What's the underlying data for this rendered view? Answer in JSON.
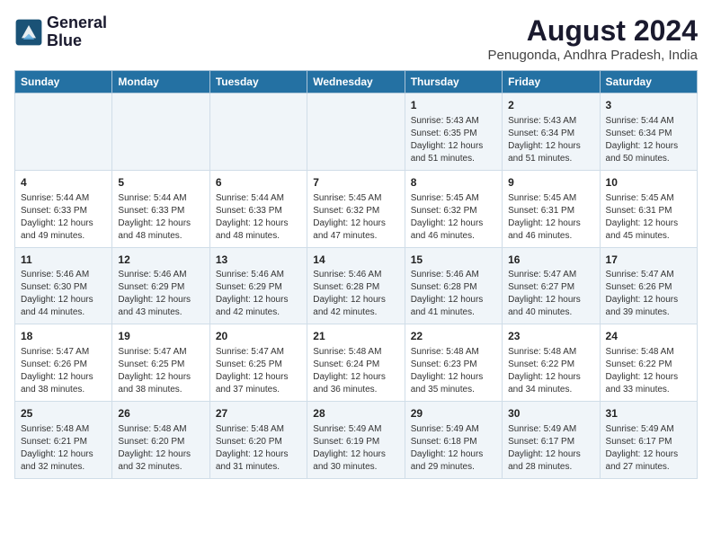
{
  "header": {
    "logo_line1": "General",
    "logo_line2": "Blue",
    "month": "August 2024",
    "location": "Penugonda, Andhra Pradesh, India"
  },
  "days_of_week": [
    "Sunday",
    "Monday",
    "Tuesday",
    "Wednesday",
    "Thursday",
    "Friday",
    "Saturday"
  ],
  "weeks": [
    [
      {
        "day": "",
        "info": ""
      },
      {
        "day": "",
        "info": ""
      },
      {
        "day": "",
        "info": ""
      },
      {
        "day": "",
        "info": ""
      },
      {
        "day": "1",
        "info": "Sunrise: 5:43 AM\nSunset: 6:35 PM\nDaylight: 12 hours and 51 minutes."
      },
      {
        "day": "2",
        "info": "Sunrise: 5:43 AM\nSunset: 6:34 PM\nDaylight: 12 hours and 51 minutes."
      },
      {
        "day": "3",
        "info": "Sunrise: 5:44 AM\nSunset: 6:34 PM\nDaylight: 12 hours and 50 minutes."
      }
    ],
    [
      {
        "day": "4",
        "info": "Sunrise: 5:44 AM\nSunset: 6:33 PM\nDaylight: 12 hours and 49 minutes."
      },
      {
        "day": "5",
        "info": "Sunrise: 5:44 AM\nSunset: 6:33 PM\nDaylight: 12 hours and 48 minutes."
      },
      {
        "day": "6",
        "info": "Sunrise: 5:44 AM\nSunset: 6:33 PM\nDaylight: 12 hours and 48 minutes."
      },
      {
        "day": "7",
        "info": "Sunrise: 5:45 AM\nSunset: 6:32 PM\nDaylight: 12 hours and 47 minutes."
      },
      {
        "day": "8",
        "info": "Sunrise: 5:45 AM\nSunset: 6:32 PM\nDaylight: 12 hours and 46 minutes."
      },
      {
        "day": "9",
        "info": "Sunrise: 5:45 AM\nSunset: 6:31 PM\nDaylight: 12 hours and 46 minutes."
      },
      {
        "day": "10",
        "info": "Sunrise: 5:45 AM\nSunset: 6:31 PM\nDaylight: 12 hours and 45 minutes."
      }
    ],
    [
      {
        "day": "11",
        "info": "Sunrise: 5:46 AM\nSunset: 6:30 PM\nDaylight: 12 hours and 44 minutes."
      },
      {
        "day": "12",
        "info": "Sunrise: 5:46 AM\nSunset: 6:29 PM\nDaylight: 12 hours and 43 minutes."
      },
      {
        "day": "13",
        "info": "Sunrise: 5:46 AM\nSunset: 6:29 PM\nDaylight: 12 hours and 42 minutes."
      },
      {
        "day": "14",
        "info": "Sunrise: 5:46 AM\nSunset: 6:28 PM\nDaylight: 12 hours and 42 minutes."
      },
      {
        "day": "15",
        "info": "Sunrise: 5:46 AM\nSunset: 6:28 PM\nDaylight: 12 hours and 41 minutes."
      },
      {
        "day": "16",
        "info": "Sunrise: 5:47 AM\nSunset: 6:27 PM\nDaylight: 12 hours and 40 minutes."
      },
      {
        "day": "17",
        "info": "Sunrise: 5:47 AM\nSunset: 6:26 PM\nDaylight: 12 hours and 39 minutes."
      }
    ],
    [
      {
        "day": "18",
        "info": "Sunrise: 5:47 AM\nSunset: 6:26 PM\nDaylight: 12 hours and 38 minutes."
      },
      {
        "day": "19",
        "info": "Sunrise: 5:47 AM\nSunset: 6:25 PM\nDaylight: 12 hours and 38 minutes."
      },
      {
        "day": "20",
        "info": "Sunrise: 5:47 AM\nSunset: 6:25 PM\nDaylight: 12 hours and 37 minutes."
      },
      {
        "day": "21",
        "info": "Sunrise: 5:48 AM\nSunset: 6:24 PM\nDaylight: 12 hours and 36 minutes."
      },
      {
        "day": "22",
        "info": "Sunrise: 5:48 AM\nSunset: 6:23 PM\nDaylight: 12 hours and 35 minutes."
      },
      {
        "day": "23",
        "info": "Sunrise: 5:48 AM\nSunset: 6:22 PM\nDaylight: 12 hours and 34 minutes."
      },
      {
        "day": "24",
        "info": "Sunrise: 5:48 AM\nSunset: 6:22 PM\nDaylight: 12 hours and 33 minutes."
      }
    ],
    [
      {
        "day": "25",
        "info": "Sunrise: 5:48 AM\nSunset: 6:21 PM\nDaylight: 12 hours and 32 minutes."
      },
      {
        "day": "26",
        "info": "Sunrise: 5:48 AM\nSunset: 6:20 PM\nDaylight: 12 hours and 32 minutes."
      },
      {
        "day": "27",
        "info": "Sunrise: 5:48 AM\nSunset: 6:20 PM\nDaylight: 12 hours and 31 minutes."
      },
      {
        "day": "28",
        "info": "Sunrise: 5:49 AM\nSunset: 6:19 PM\nDaylight: 12 hours and 30 minutes."
      },
      {
        "day": "29",
        "info": "Sunrise: 5:49 AM\nSunset: 6:18 PM\nDaylight: 12 hours and 29 minutes."
      },
      {
        "day": "30",
        "info": "Sunrise: 5:49 AM\nSunset: 6:17 PM\nDaylight: 12 hours and 28 minutes."
      },
      {
        "day": "31",
        "info": "Sunrise: 5:49 AM\nSunset: 6:17 PM\nDaylight: 12 hours and 27 minutes."
      }
    ]
  ]
}
